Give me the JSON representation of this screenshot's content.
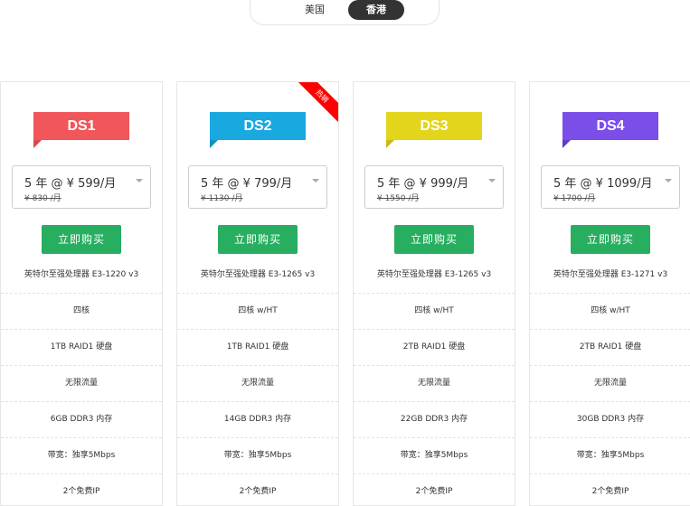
{
  "tabs": [
    {
      "label": "美国",
      "active": false
    },
    {
      "label": "香港",
      "active": true
    }
  ],
  "hot_label": "热销",
  "buy_label": "立即购买",
  "plans": [
    {
      "name": "DS1",
      "color": "#f0565a",
      "tail": "#d9484c",
      "price": "5 年 @ ¥ 599/月",
      "old_price": "¥ 830 /月",
      "specs": [
        "英特尔至强处理器 E3-1220 v3",
        "四核",
        "1TB RAID1 硬盘",
        "无限流量",
        "6GB DDR3 内存",
        "带宽：独享5Mbps",
        "2个免费IP"
      ]
    },
    {
      "name": "DS2",
      "color": "#19a8e0",
      "tail": "#1290c0",
      "hot": true,
      "price": "5 年 @ ¥ 799/月",
      "old_price": "¥ 1130 /月",
      "specs": [
        "英特尔至强处理器 E3-1265 v3",
        "四核 w/HT",
        "1TB RAID1 硬盘",
        "无限流量",
        "14GB DDR3 内存",
        "带宽：独享5Mbps",
        "2个免费IP"
      ]
    },
    {
      "name": "DS3",
      "color": "#e3d41c",
      "tail": "#c9bb14",
      "price": "5 年 @ ¥ 999/月",
      "old_price": "¥ 1550 /月",
      "specs": [
        "英特尔至强处理器 E3-1265 v3",
        "四核 w/HT",
        "2TB RAID1 硬盘",
        "无限流量",
        "22GB DDR3 内存",
        "带宽：独享5Mbps",
        "2个免费IP"
      ]
    },
    {
      "name": "DS4",
      "color": "#7b4de9",
      "tail": "#6538cf",
      "price": "5 年 @ ¥ 1099/月",
      "old_price": "¥ 1700 /月",
      "specs": [
        "英特尔至强处理器 E3-1271 v3",
        "四核 w/HT",
        "2TB RAID1 硬盘",
        "无限流量",
        "30GB DDR3 内存",
        "带宽：独享5Mbps",
        "2个免费IP"
      ]
    }
  ]
}
